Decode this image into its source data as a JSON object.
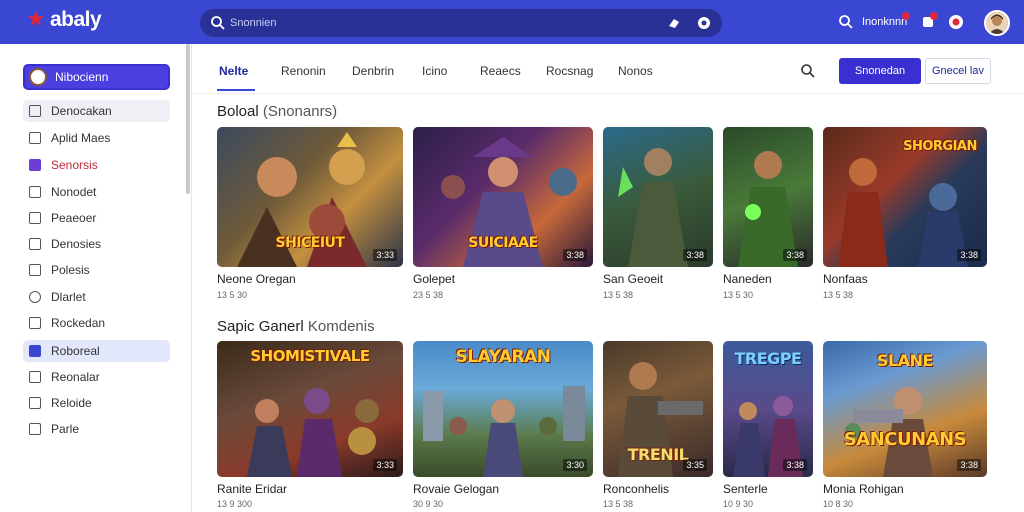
{
  "app": {
    "logo_text": "abaly",
    "search_placeholder": "Snonnien"
  },
  "topbar": {
    "right_link": "Inonknnn"
  },
  "sidebar": {
    "profile_label": "Nibocienn",
    "items": [
      {
        "label": "Denocakan",
        "icon": "document-icon"
      },
      {
        "label": "Aplid Maes",
        "icon": "arrow-icon"
      },
      {
        "label": "Senorsis",
        "icon": "check-icon"
      },
      {
        "label": "Nonodet",
        "icon": "clock-icon"
      },
      {
        "label": "Peaeoer",
        "icon": "video-icon"
      },
      {
        "label": "Denosies",
        "icon": "list-icon"
      },
      {
        "label": "Polesis",
        "icon": "clipboard-icon"
      },
      {
        "label": "Dlarlet",
        "icon": "circle-icon"
      },
      {
        "label": "Rockedan",
        "icon": "square-icon"
      },
      {
        "label": "Roboreal",
        "icon": "folder-icon"
      },
      {
        "label": "Reonalar",
        "icon": "tv-icon"
      },
      {
        "label": "Reloide",
        "icon": "tag-icon"
      },
      {
        "label": "Parle",
        "icon": "page-icon"
      }
    ]
  },
  "tabs": [
    {
      "label": "Nelte"
    },
    {
      "label": "Renonin"
    },
    {
      "label": "Denbrin"
    },
    {
      "label": "Icino"
    },
    {
      "label": "Reaecs"
    },
    {
      "label": "Rocsnag"
    },
    {
      "label": "Nonos"
    }
  ],
  "actions": {
    "primary": "Snonedan",
    "secondary": "Gnecel lav"
  },
  "sections": [
    {
      "title": "Boloal",
      "subtitle": "(Snonanrs)",
      "cards": [
        {
          "title": "Neone Oregan",
          "meta": "13 5 30",
          "duration": "3:33",
          "art": "SHICEIUT"
        },
        {
          "title": "Golepet",
          "meta": "23 5 38",
          "duration": "3:38",
          "art": "SUICIAAE"
        },
        {
          "title": "San Geoeit",
          "meta": "13 5 38",
          "duration": "3:38",
          "art": ""
        },
        {
          "title": "Naneden",
          "meta": "13 5 30",
          "duration": "3:38",
          "art": ""
        },
        {
          "title": "Nonfaas",
          "meta": "13 5 38",
          "duration": "3:38",
          "art": "SHORGIAN"
        }
      ]
    },
    {
      "title": "Sapic Ganerl",
      "subtitle": "Komdenis",
      "cards": [
        {
          "title": "Ranite Eridar",
          "meta": "13 9 300",
          "duration": "3:33",
          "art": "SHOMISTIVALE"
        },
        {
          "title": "Rovaie Gelogan",
          "meta": "30 9 30",
          "duration": "3:30",
          "art": "SLAYARAN"
        },
        {
          "title": "Ronconhelis",
          "meta": "13 5 38",
          "duration": "3:35",
          "art": "TRENIL"
        },
        {
          "title": "Senterle",
          "meta": "10 9 30",
          "duration": "3:38",
          "art": "TREGPE"
        },
        {
          "title": "Monia Rohigan",
          "meta": "10 8 30",
          "duration": "3:38",
          "art": "SANCUNANS"
        }
      ]
    }
  ],
  "colors": {
    "brand": "#3a47d3",
    "primary_button": "#3a2fd0",
    "accent_red": "#e0283a"
  }
}
